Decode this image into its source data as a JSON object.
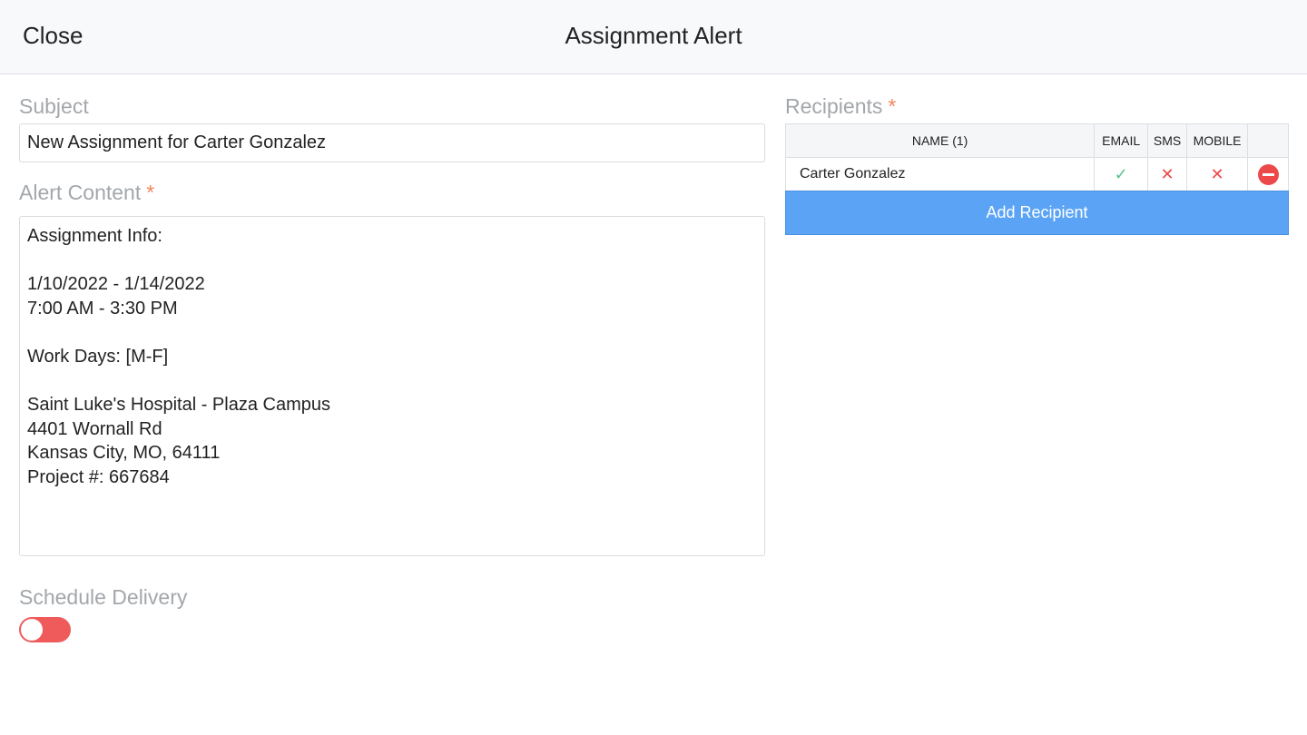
{
  "header": {
    "close_label": "Close",
    "title": "Assignment Alert"
  },
  "subject": {
    "label": "Subject",
    "value": "New Assignment for Carter Gonzalez"
  },
  "alert_content": {
    "label": "Alert Content",
    "required_mark": "*",
    "lines": [
      "Assignment Info:",
      "",
      "1/10/2022 - 1/14/2022",
      "7:00 AM - 3:30 PM",
      "",
      "Work Days: [M-F]",
      "",
      "Saint Luke's Hospital - Plaza Campus",
      "4401 Wornall Rd",
      "Kansas City, MO, 64111",
      "Project #: 667684"
    ]
  },
  "schedule": {
    "label": "Schedule Delivery",
    "enabled": false,
    "toggle_color": "#ef5a5a"
  },
  "recipients": {
    "label": "Recipients",
    "required_mark": "*",
    "columns": {
      "name": "NAME (1)",
      "email": "EMAIL",
      "sms": "SMS",
      "mobile": "MOBILE"
    },
    "rows": [
      {
        "name": "Carter Gonzalez",
        "email": "✓",
        "sms": "✕",
        "mobile": "✕"
      }
    ],
    "add_label": "Add Recipient",
    "accent_color": "#5ba4f5"
  }
}
